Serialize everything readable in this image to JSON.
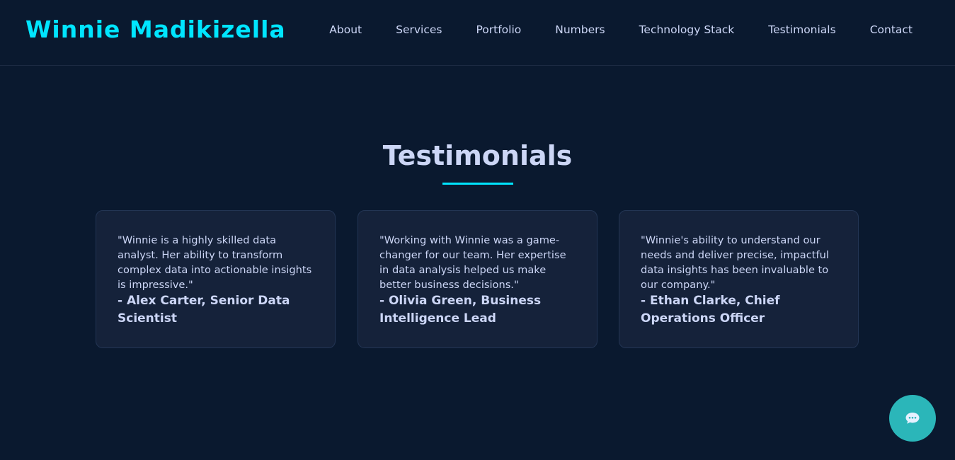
{
  "header": {
    "logo": "Winnie Madikizella",
    "nav": [
      "About",
      "Services",
      "Portfolio",
      "Numbers",
      "Technology Stack",
      "Testimonials",
      "Contact"
    ]
  },
  "section": {
    "title": "Testimonials"
  },
  "testimonials": [
    {
      "quote": "\"Winnie is a highly skilled data analyst. Her ability to transform complex data into actionable insights is impressive.\"",
      "author": "- Alex Carter, Senior Data Scientist"
    },
    {
      "quote": "\"Working with Winnie was a game-changer for our team. Her expertise in data analysis helped us make better business decisions.\"",
      "author": "- Olivia Green, Business Intelligence Lead"
    },
    {
      "quote": "\"Winnie's ability to understand our needs and deliver precise, impactful data insights has been invaluable to our company.\"",
      "author": "- Ethan Clarke, Chief Operations Officer"
    }
  ],
  "chat": {
    "icon": "chat-bubble-icon"
  },
  "colors": {
    "background": "#0a192f",
    "accent": "#00e5ff",
    "card": "#15223a",
    "text": "#ccd6f6",
    "chat_button": "#2bb6b9"
  }
}
